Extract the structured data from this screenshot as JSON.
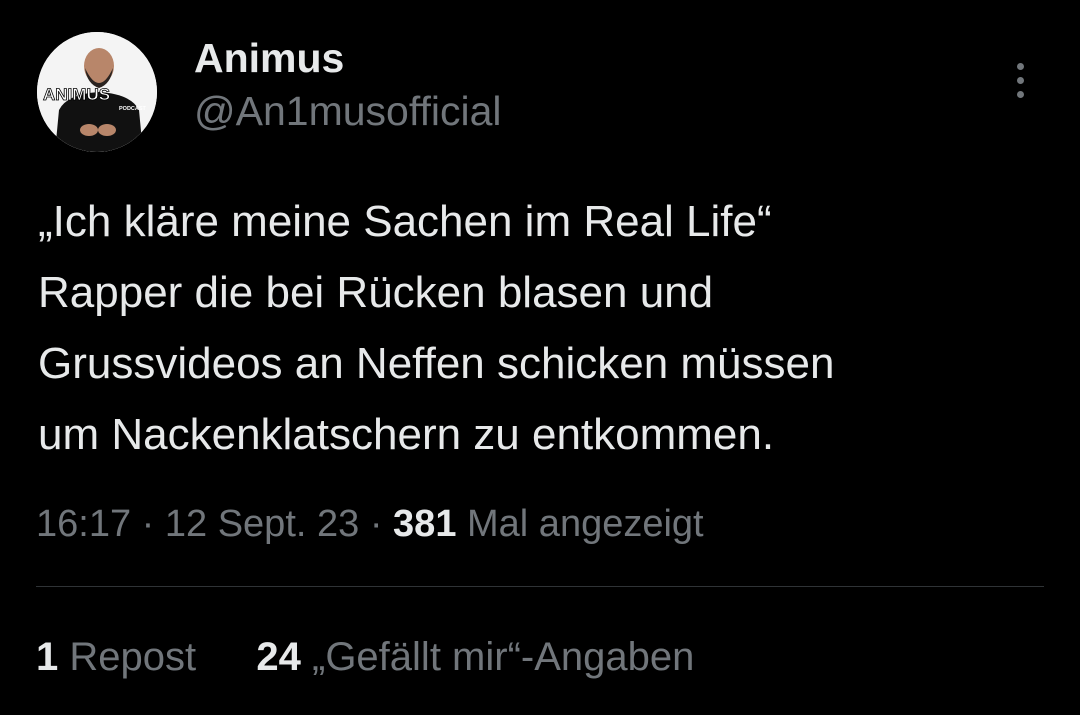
{
  "author": {
    "display_name": "Animus",
    "handle": "@An1musofficial",
    "avatar": {
      "logo_text": "ANIMUS",
      "logo_subtext": "PODCAST"
    }
  },
  "tweet": {
    "text_lines": [
      "„Ich kläre meine Sachen im Real Life“",
      "Rapper die bei Rücken blasen und",
      "Grussvideos an Neffen schicken müssen",
      "um Nackenklatschern zu entkommen."
    ]
  },
  "meta": {
    "time": "16:17",
    "separator": "·",
    "date": "12 Sept. 23",
    "views_count": "381",
    "views_label": "Mal angezeigt"
  },
  "stats": {
    "reposts_count": "1",
    "reposts_label": "Repost",
    "likes_count": "24",
    "likes_label": "„Gefällt mir“-Angaben"
  },
  "icons": {
    "more": "more-vertical-icon"
  },
  "colors": {
    "background": "#000000",
    "primary_text": "#e7e9ea",
    "secondary_text": "#71767b",
    "divider": "#2f3336"
  }
}
